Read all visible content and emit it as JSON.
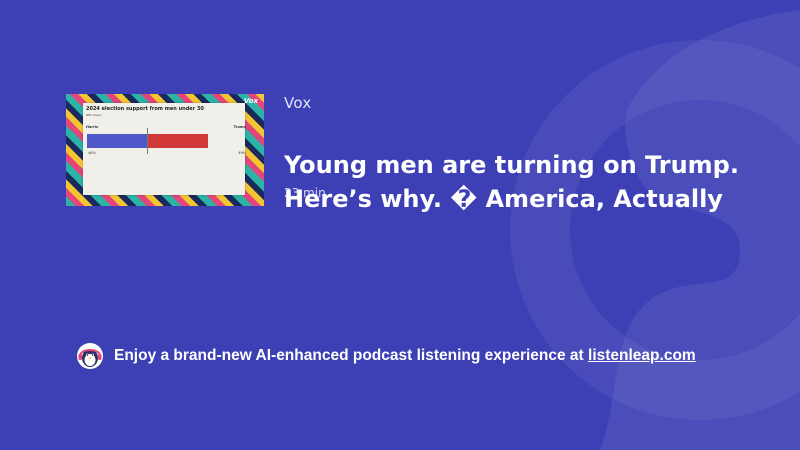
{
  "episode": {
    "publisher": "Vox",
    "title": "Young men are turning on Trump. Here’s why. � America, Actually",
    "duration": "23 min"
  },
  "thumbnail": {
    "chart_title": "2024 election support from men under 30",
    "chart_subtitle": "NBC News",
    "left_label": "Harris",
    "right_label": "Trump",
    "left_value": "46%",
    "right_value": "49%",
    "brand": "Vox"
  },
  "footer": {
    "text": "Enjoy a brand-new AI-enhanced podcast listening experience at ",
    "link_text": "listenleap.com"
  },
  "colors": {
    "background": "#3d40b5",
    "harris_blue": "#4f58c9",
    "trump_red": "#d23a3a"
  },
  "icons": {
    "background": "podcast-logo-watermark-icon",
    "footer": "penguin-headphones-mascot-icon"
  }
}
